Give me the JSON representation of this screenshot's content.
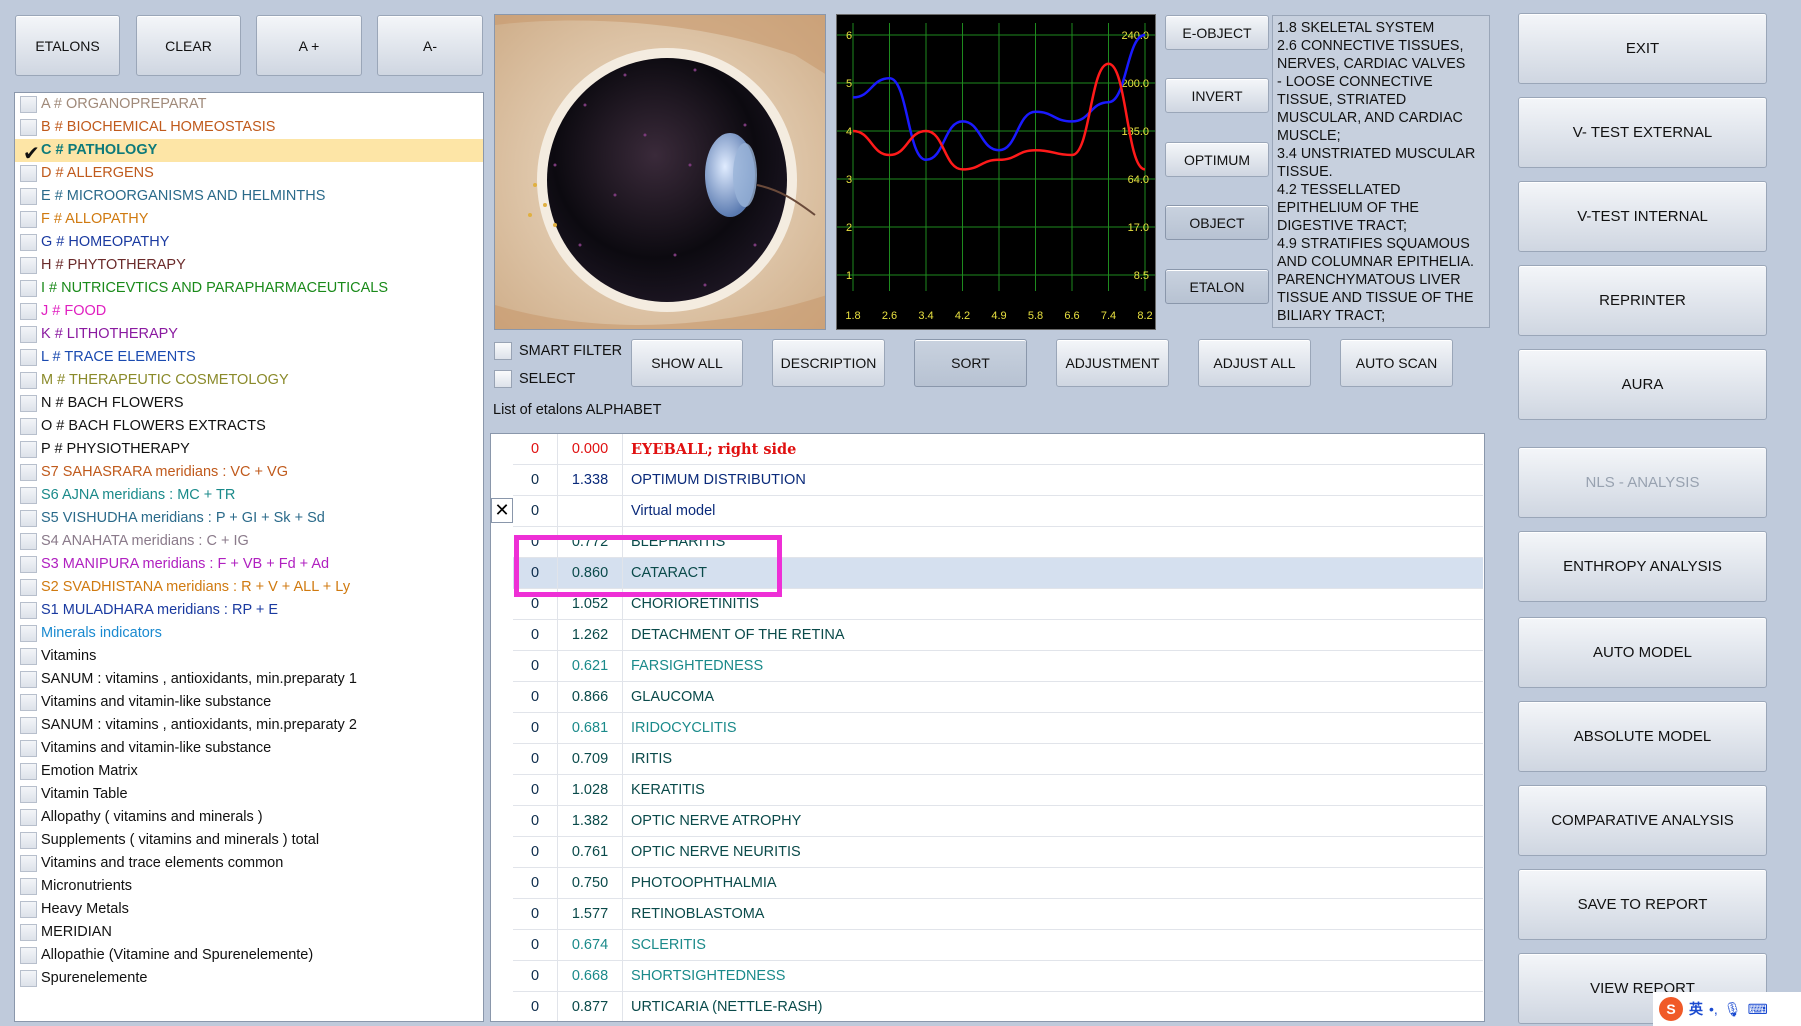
{
  "toolbar": {
    "etalons": "ETALONS",
    "clear": "CLEAR",
    "a_plus": "A +",
    "a_minus": "A-"
  },
  "categories": [
    {
      "label": "A # ORGANOPREPARAT",
      "color": "#a08a7a",
      "checked": false
    },
    {
      "label": "B # BIOCHEMICAL HOMEOSTASIS",
      "color": "#c05a1c",
      "checked": false
    },
    {
      "label": "C # PATHOLOGY",
      "color": "#0e7a7a",
      "checked": true
    },
    {
      "label": "D # ALLERGENS",
      "color": "#c05a1c",
      "checked": false
    },
    {
      "label": "E # MICROORGANISMS AND HELMINTHS",
      "color": "#2a6a8a",
      "checked": false
    },
    {
      "label": "F # ALLOPATHY",
      "color": "#d07a10",
      "checked": false
    },
    {
      "label": "G # HOMEOPATHY",
      "color": "#1a3aa0",
      "checked": false
    },
    {
      "label": "H # PHYTOTHERAPY",
      "color": "#6a2a2a",
      "checked": false
    },
    {
      "label": "I # NUTRICEVTICS AND PARAPHARMACEUTICALS",
      "color": "#1a8a1a",
      "checked": false
    },
    {
      "label": "J # FOOD",
      "color": "#e020c0",
      "checked": false
    },
    {
      "label": "K # LITHOTHERAPY",
      "color": "#8a1aa0",
      "checked": false
    },
    {
      "label": "L # TRACE ELEMENTS",
      "color": "#1a4ab0",
      "checked": false
    },
    {
      "label": "M # THERAPEUTIC COSMETOLOGY",
      "color": "#8a8a2a",
      "checked": false
    },
    {
      "label": "N # BACH FLOWERS",
      "color": "#111111",
      "checked": false
    },
    {
      "label": "O # BACH FLOWERS EXTRACTS",
      "color": "#111111",
      "checked": false
    },
    {
      "label": "P # PHYSIOTHERAPY",
      "color": "#111111",
      "checked": false
    },
    {
      "label": "S7 SAHASRARA meridians : VC + VG",
      "color": "#c05a1c",
      "checked": false
    },
    {
      "label": "S6 AJNA meridians : MC + TR",
      "color": "#1a8a8a",
      "checked": false
    },
    {
      "label": "S5 VISHUDHA meridians : P + GI + Sk + Sd",
      "color": "#2a6a8a",
      "checked": false
    },
    {
      "label": "S4 ANAHATA meridians : C + IG",
      "color": "#8a7a8a",
      "checked": false
    },
    {
      "label": "S3 MANIPURA meridians : F + VB + Fd + Ad",
      "color": "#b020c0",
      "checked": false
    },
    {
      "label": "S2 SVADHISTANA meridians : R + V + ALL + Ly",
      "color": "#d07a10",
      "checked": false
    },
    {
      "label": "S1 MULADHARA meridians : RP + E",
      "color": "#1a3aa0",
      "checked": false
    },
    {
      "label": "Minerals indicators",
      "color": "#1a8ad0",
      "checked": false
    },
    {
      "label": "Vitamins",
      "color": "#111111",
      "checked": false
    },
    {
      "label": "SANUM : vitamins , antioxidants, min.preparaty 1",
      "color": "#111111",
      "checked": false
    },
    {
      "label": "Vitamins and vitamin-like substance",
      "color": "#111111",
      "checked": false
    },
    {
      "label": "SANUM : vitamins , antioxidants, min.preparaty 2",
      "color": "#111111",
      "checked": false
    },
    {
      "label": "Vitamins and vitamin-like substance",
      "color": "#111111",
      "checked": false
    },
    {
      "label": "Emotion Matrix",
      "color": "#111111",
      "checked": false
    },
    {
      "label": "Vitamin Table",
      "color": "#111111",
      "checked": false
    },
    {
      "label": "Allopathy ( vitamins and minerals )",
      "color": "#111111",
      "checked": false
    },
    {
      "label": "Supplements ( vitamins and minerals ) total",
      "color": "#111111",
      "checked": false
    },
    {
      "label": "Vitamins and trace elements common",
      "color": "#111111",
      "checked": false
    },
    {
      "label": "Micronutrients",
      "color": "#111111",
      "checked": false
    },
    {
      "label": "Heavy Metals",
      "color": "#111111",
      "checked": false
    },
    {
      "label": "MERIDIAN",
      "color": "#111111",
      "checked": false
    },
    {
      "label": "Allopathie (Vitamine and Spurenelemente)",
      "color": "#111111",
      "checked": false
    },
    {
      "label": "Spurenelemente",
      "color": "#111111",
      "checked": false
    }
  ],
  "graph": {
    "left_axis": [
      "6",
      "5",
      "4",
      "3",
      "2",
      "1"
    ],
    "right_axis": [
      "240.0",
      "200.0",
      "135.0",
      "64.0",
      "17.0",
      "8.5"
    ],
    "bottom_axis": [
      "1.8",
      "2.6",
      "3.4",
      "4.2",
      "4.9",
      "5.8",
      "6.6",
      "7.4",
      "8.2"
    ],
    "grid_color": "#1e8a1e",
    "blue_color": "#1a1aff",
    "red_color": "#ff1a1a",
    "blue_curve": [
      4.7,
      5.1,
      3.4,
      4.2,
      3.6,
      4.4,
      4.2,
      4.6,
      6.0
    ],
    "red_curve": [
      4.0,
      3.5,
      4.0,
      3.2,
      3.4,
      3.6,
      3.5,
      5.4,
      3.2
    ]
  },
  "side_buttons": {
    "e_object": "E-OBJECT",
    "invert": "INVERT",
    "optimum": "OPTIMUM",
    "object": "OBJECT",
    "etalon": "ETALON"
  },
  "description": "1.8 SKELETAL SYSTEM\n2.6 CONNECTIVE TISSUES, NERVES, CARDIAC VALVES\n- LOOSE CONNECTIVE TISSUE, STRIATED MUSCULAR, AND CARDIAC MUSCLE;\n3.4 UNSTRIATED MUSCULAR TISSUE.\n4.2 TESSELLATED EPITHELIUM OF THE DIGESTIVE TRACT;\n4.9 STRATIFIES SQUAMOUS AND COLUMNAR EPITHELIA. PARENCHYMATOUS LIVER TISSUE AND TISSUE OF THE BILIARY TRACT;",
  "filters": {
    "smart_filter": "SMART FILTER",
    "select": "SELECT"
  },
  "actions": {
    "show_all": "SHOW ALL",
    "description": "DESCRIPTION",
    "sort": "SORT",
    "adjustment": "ADJUSTMENT",
    "adjust_all": "ADJUST ALL",
    "auto_scan": "AUTO SCAN"
  },
  "list_title": "List of etalons ALPHABET",
  "etalons": [
    {
      "n": "0",
      "v": "0.000",
      "name": "EYEBALL; right side",
      "color": "#e01010",
      "bold": true
    },
    {
      "n": "0",
      "v": "1.338",
      "name": "OPTIMUM DISTRIBUTION",
      "color": "#0a2a7a"
    },
    {
      "n": "0",
      "v": "",
      "name": "Virtual model",
      "color": "#0a2a7a"
    },
    {
      "n": "0",
      "v": "0.772",
      "name": "BLEPHARITIS",
      "color": "#0a4a4a"
    },
    {
      "n": "0",
      "v": "0.860",
      "name": "CATARACT",
      "color": "#0a4a4a",
      "highlight": true
    },
    {
      "n": "0",
      "v": "1.052",
      "name": "CHORIORETINITIS",
      "color": "#0a4a4a"
    },
    {
      "n": "0",
      "v": "1.262",
      "name": "DETACHMENT OF THE RETINA",
      "color": "#0a4a4a"
    },
    {
      "n": "0",
      "v": "0.621",
      "name": "FARSIGHTEDNESS",
      "color": "#1a8a8a"
    },
    {
      "n": "0",
      "v": "0.866",
      "name": "GLAUCOMA",
      "color": "#0a4a4a"
    },
    {
      "n": "0",
      "v": "0.681",
      "name": "IRIDOCYCLITIS",
      "color": "#1a8a8a"
    },
    {
      "n": "0",
      "v": "0.709",
      "name": "IRITIS",
      "color": "#0a4a4a"
    },
    {
      "n": "0",
      "v": "1.028",
      "name": "KERATITIS",
      "color": "#0a4a4a"
    },
    {
      "n": "0",
      "v": "1.382",
      "name": "OPTIC  NERVE  ATROPHY",
      "color": "#0a4a4a"
    },
    {
      "n": "0",
      "v": "0.761",
      "name": "OPTIC  NERVE  NEURITIS",
      "color": "#0a4a4a"
    },
    {
      "n": "0",
      "v": "0.750",
      "name": "PHOTOOPHTHALMIA",
      "color": "#0a4a4a"
    },
    {
      "n": "0",
      "v": "1.577",
      "name": "RETINOBLASTOMA",
      "color": "#0a4a4a"
    },
    {
      "n": "0",
      "v": "0.674",
      "name": "SCLERITIS",
      "color": "#1a8a8a"
    },
    {
      "n": "0",
      "v": "0.668",
      "name": "SHORTSIGHTEDNESS",
      "color": "#1a8a8a"
    },
    {
      "n": "0",
      "v": "0.877",
      "name": "URTICARIA (NETTLE-RASH)",
      "color": "#0a4a4a"
    }
  ],
  "right_buttons": {
    "exit": "EXIT",
    "v_test_external": "V- TEST EXTERNAL",
    "v_test_internal": "V-TEST INTERNAL",
    "reprinter": "REPRINTER",
    "aura": "AURA",
    "nls_analysis": "NLS - ANALYSIS",
    "enthropy_analysis": "ENTHROPY ANALYSIS",
    "auto_model": "AUTO MODEL",
    "absolute_model": "ABSOLUTE MODEL",
    "comparative_analysis": "COMPARATIVE ANALYSIS",
    "save_to_report": "SAVE TO REPORT",
    "view_report": "VIEW REPORT"
  },
  "ime": {
    "lang": "英"
  }
}
